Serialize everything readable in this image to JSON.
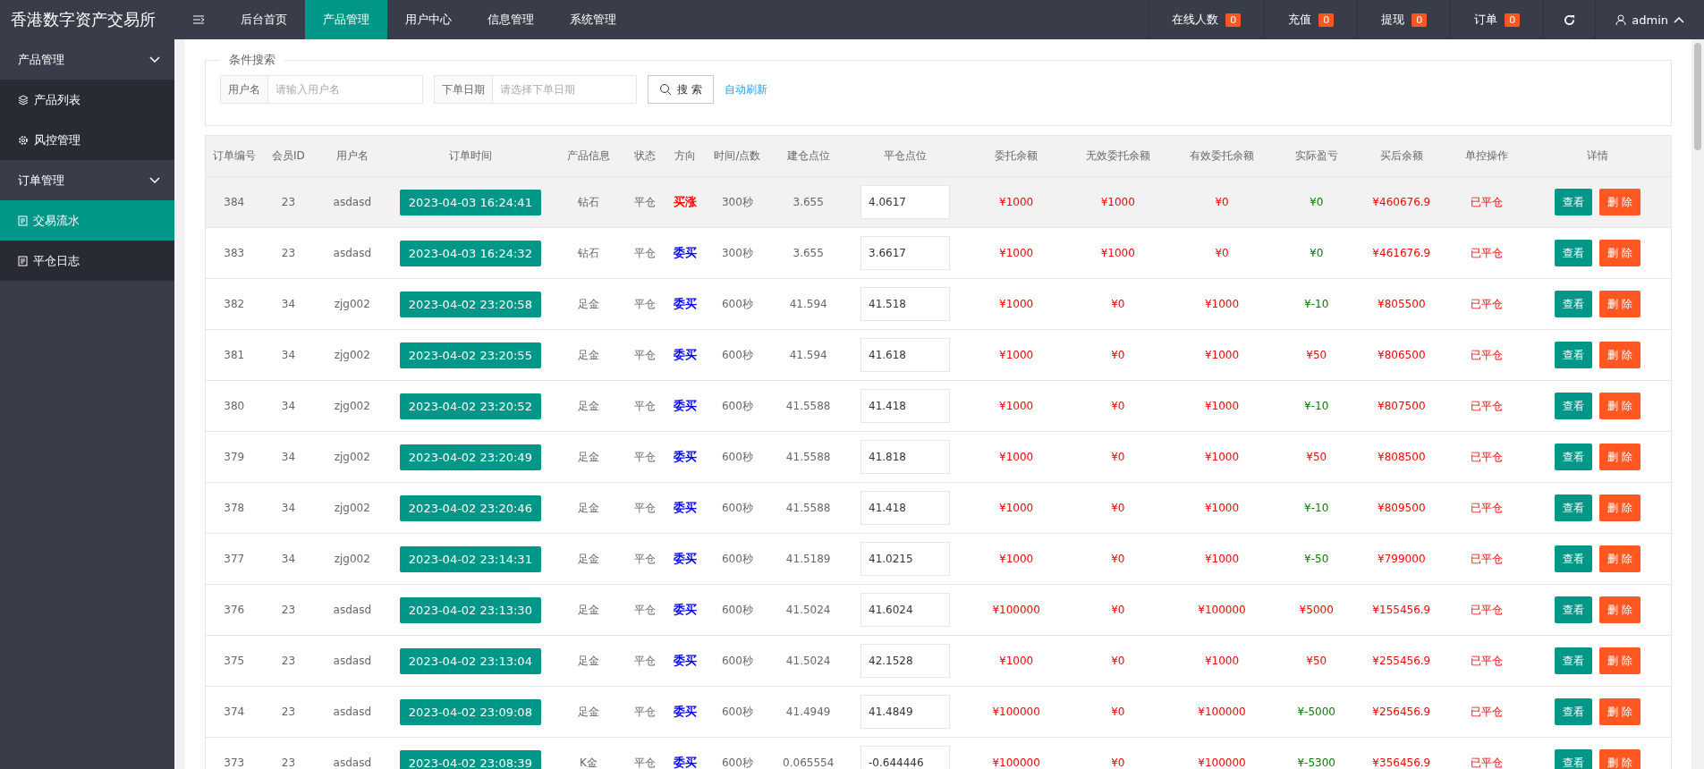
{
  "logo": "香港数字资产交易所",
  "nav": [
    {
      "label": "后台首页",
      "selected": false
    },
    {
      "label": "产品管理",
      "selected": true
    },
    {
      "label": "用户中心",
      "selected": false
    },
    {
      "label": "信息管理",
      "selected": false
    },
    {
      "label": "系统管理",
      "selected": false
    }
  ],
  "stats": [
    {
      "label": "在线人数",
      "count": "0"
    },
    {
      "label": "充值",
      "count": "0"
    },
    {
      "label": "提现",
      "count": "0"
    },
    {
      "label": "订单",
      "count": "0"
    }
  ],
  "user": {
    "name": "admin",
    "expanded": true
  },
  "sidebar": [
    {
      "label": "产品管理",
      "expanded": true,
      "children": [
        {
          "label": "产品列表",
          "kind": "layers",
          "selected": false
        },
        {
          "label": "风控管理",
          "kind": "gear",
          "selected": false
        }
      ]
    },
    {
      "label": "订单管理",
      "expanded": true,
      "children": [
        {
          "label": "交易流水",
          "kind": "doc",
          "selected": true
        },
        {
          "label": "平仓日志",
          "kind": "doc",
          "selected": false
        }
      ]
    }
  ],
  "search": {
    "legend": "条件搜索",
    "fields": [
      {
        "label": "用户名",
        "placeholder": "请输入用户名"
      },
      {
        "label": "下单日期",
        "placeholder": "请选择下单日期"
      }
    ],
    "button": "搜 索",
    "link": "自动刷新"
  },
  "table": {
    "columns": [
      "订单编号",
      "会员ID",
      "用户名",
      "订单时间",
      "产品信息",
      "状态",
      "方向",
      "时间/点数",
      "建仓点位",
      "平仓点位",
      "委托余额",
      "无效委托余额",
      "有效委托余额",
      "实际盈亏",
      "买后余额",
      "单控操作",
      "详情"
    ],
    "rows": [
      {
        "selected": true,
        "id": "384",
        "member": "23",
        "user": "asdasd",
        "time": "2023-04-03 16:24:41",
        "product": "钻石",
        "state": "平仓",
        "direction": {
          "text": "买涨",
          "color": "#ff0000"
        },
        "duration": "300秒",
        "open": "3.655",
        "close": "4.0617",
        "amount": "¥1000",
        "invalid": "¥1000",
        "valid": "¥0",
        "profit": {
          "text": "¥0",
          "color": "#008000"
        },
        "after": "¥460676.9",
        "control": "已平仓",
        "actions": [
          "查看",
          "删 除"
        ]
      },
      {
        "selected": false,
        "id": "383",
        "member": "23",
        "user": "asdasd",
        "time": "2023-04-03 16:24:32",
        "product": "钻石",
        "state": "平仓",
        "direction": {
          "text": "委买",
          "color": "#0000ff"
        },
        "duration": "300秒",
        "open": "3.655",
        "close": "3.6617",
        "amount": "¥1000",
        "invalid": "¥1000",
        "valid": "¥0",
        "profit": {
          "text": "¥0",
          "color": "#008000"
        },
        "after": "¥461676.9",
        "control": "已平仓",
        "actions": [
          "查看",
          "删 除"
        ]
      },
      {
        "selected": false,
        "id": "382",
        "member": "34",
        "user": "zjg002",
        "time": "2023-04-02 23:20:58",
        "product": "足金",
        "state": "平仓",
        "direction": {
          "text": "委买",
          "color": "#0000ff"
        },
        "duration": "600秒",
        "open": "41.594",
        "close": "41.518",
        "amount": "¥1000",
        "invalid": "¥0",
        "valid": "¥1000",
        "profit": {
          "text": "¥-10",
          "color": "#008000"
        },
        "after": "¥805500",
        "control": "已平仓",
        "actions": [
          "查看",
          "删 除"
        ]
      },
      {
        "selected": false,
        "id": "381",
        "member": "34",
        "user": "zjg002",
        "time": "2023-04-02 23:20:55",
        "product": "足金",
        "state": "平仓",
        "direction": {
          "text": "委买",
          "color": "#0000ff"
        },
        "duration": "600秒",
        "open": "41.594",
        "close": "41.618",
        "amount": "¥1000",
        "invalid": "¥0",
        "valid": "¥1000",
        "profit": {
          "text": "¥50",
          "color": "#ff0000"
        },
        "after": "¥806500",
        "control": "已平仓",
        "actions": [
          "查看",
          "删 除"
        ]
      },
      {
        "selected": false,
        "id": "380",
        "member": "34",
        "user": "zjg002",
        "time": "2023-04-02 23:20:52",
        "product": "足金",
        "state": "平仓",
        "direction": {
          "text": "委买",
          "color": "#0000ff"
        },
        "duration": "600秒",
        "open": "41.5588",
        "close": "41.418",
        "amount": "¥1000",
        "invalid": "¥0",
        "valid": "¥1000",
        "profit": {
          "text": "¥-10",
          "color": "#008000"
        },
        "after": "¥807500",
        "control": "已平仓",
        "actions": [
          "查看",
          "删 除"
        ]
      },
      {
        "selected": false,
        "id": "379",
        "member": "34",
        "user": "zjg002",
        "time": "2023-04-02 23:20:49",
        "product": "足金",
        "state": "平仓",
        "direction": {
          "text": "委买",
          "color": "#0000ff"
        },
        "duration": "600秒",
        "open": "41.5588",
        "close": "41.818",
        "amount": "¥1000",
        "invalid": "¥0",
        "valid": "¥1000",
        "profit": {
          "text": "¥50",
          "color": "#ff0000"
        },
        "after": "¥808500",
        "control": "已平仓",
        "actions": [
          "查看",
          "删 除"
        ]
      },
      {
        "selected": false,
        "id": "378",
        "member": "34",
        "user": "zjg002",
        "time": "2023-04-02 23:20:46",
        "product": "足金",
        "state": "平仓",
        "direction": {
          "text": "委买",
          "color": "#0000ff"
        },
        "duration": "600秒",
        "open": "41.5588",
        "close": "41.418",
        "amount": "¥1000",
        "invalid": "¥0",
        "valid": "¥1000",
        "profit": {
          "text": "¥-10",
          "color": "#008000"
        },
        "after": "¥809500",
        "control": "已平仓",
        "actions": [
          "查看",
          "删 除"
        ]
      },
      {
        "selected": false,
        "id": "377",
        "member": "34",
        "user": "zjg002",
        "time": "2023-04-02 23:14:31",
        "product": "足金",
        "state": "平仓",
        "direction": {
          "text": "委买",
          "color": "#0000ff"
        },
        "duration": "600秒",
        "open": "41.5189",
        "close": "41.0215",
        "amount": "¥1000",
        "invalid": "¥0",
        "valid": "¥1000",
        "profit": {
          "text": "¥-50",
          "color": "#008000"
        },
        "after": "¥799000",
        "control": "已平仓",
        "actions": [
          "查看",
          "删 除"
        ]
      },
      {
        "selected": false,
        "id": "376",
        "member": "23",
        "user": "asdasd",
        "time": "2023-04-02 23:13:30",
        "product": "足金",
        "state": "平仓",
        "direction": {
          "text": "委买",
          "color": "#0000ff"
        },
        "duration": "600秒",
        "open": "41.5024",
        "close": "41.6024",
        "amount": "¥100000",
        "invalid": "¥0",
        "valid": "¥100000",
        "profit": {
          "text": "¥5000",
          "color": "#ff0000"
        },
        "after": "¥155456.9",
        "control": "已平仓",
        "actions": [
          "查看",
          "删 除"
        ]
      },
      {
        "selected": false,
        "id": "375",
        "member": "23",
        "user": "asdasd",
        "time": "2023-04-02 23:13:04",
        "product": "足金",
        "state": "平仓",
        "direction": {
          "text": "委买",
          "color": "#0000ff"
        },
        "duration": "600秒",
        "open": "41.5024",
        "close": "42.1528",
        "amount": "¥1000",
        "invalid": "¥0",
        "valid": "¥1000",
        "profit": {
          "text": "¥50",
          "color": "#ff0000"
        },
        "after": "¥255456.9",
        "control": "已平仓",
        "actions": [
          "查看",
          "删 除"
        ]
      },
      {
        "selected": false,
        "id": "374",
        "member": "23",
        "user": "asdasd",
        "time": "2023-04-02 23:09:08",
        "product": "足金",
        "state": "平仓",
        "direction": {
          "text": "委买",
          "color": "#0000ff"
        },
        "duration": "600秒",
        "open": "41.4949",
        "close": "41.4849",
        "amount": "¥100000",
        "invalid": "¥0",
        "valid": "¥100000",
        "profit": {
          "text": "¥-5000",
          "color": "#008000"
        },
        "after": "¥256456.9",
        "control": "已平仓",
        "actions": [
          "查看",
          "删 除"
        ]
      },
      {
        "selected": false,
        "id": "373",
        "member": "23",
        "user": "asdasd",
        "time": "2023-04-02 23:08:39",
        "product": "K金",
        "state": "平仓",
        "direction": {
          "text": "委买",
          "color": "#0000ff"
        },
        "duration": "600秒",
        "open": "0.065554",
        "close": "-0.644446",
        "amount": "¥100000",
        "invalid": "¥0",
        "valid": "¥100000",
        "profit": {
          "text": "¥-5300",
          "color": "#008000"
        },
        "after": "¥356456.9",
        "control": "已平仓",
        "actions": [
          "查看",
          "删 除"
        ]
      }
    ]
  }
}
